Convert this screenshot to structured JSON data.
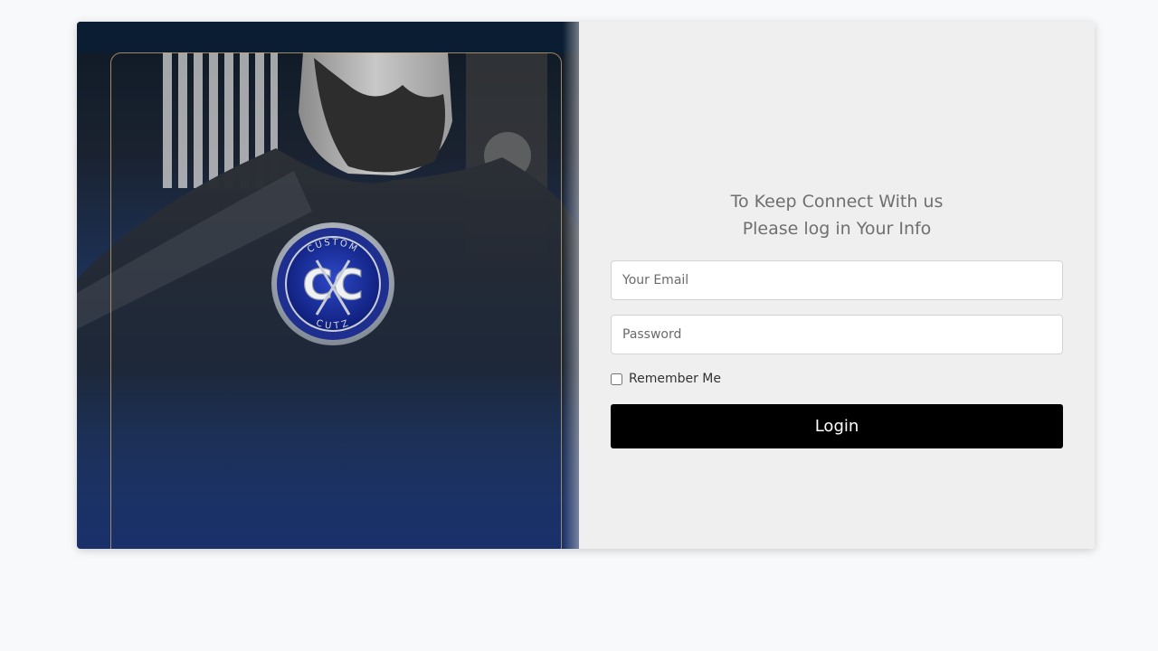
{
  "brand": {
    "logo_top_text": "CUSTOM",
    "logo_bottom_text": "CUTZ",
    "logo_initials": "CC",
    "accent_color": "#1d3766",
    "frame_color": "#bea56e"
  },
  "login": {
    "tagline": "To Keep Connect With us Please log in Your Info",
    "email_placeholder": "Your Email",
    "password_placeholder": "Password",
    "remember_label": "Remember Me",
    "remember_checked": false,
    "button_label": "Login",
    "button_color": "#000000"
  },
  "icons": {
    "hero_image": "barber-client-photo",
    "logo": "scissors-emblem"
  }
}
